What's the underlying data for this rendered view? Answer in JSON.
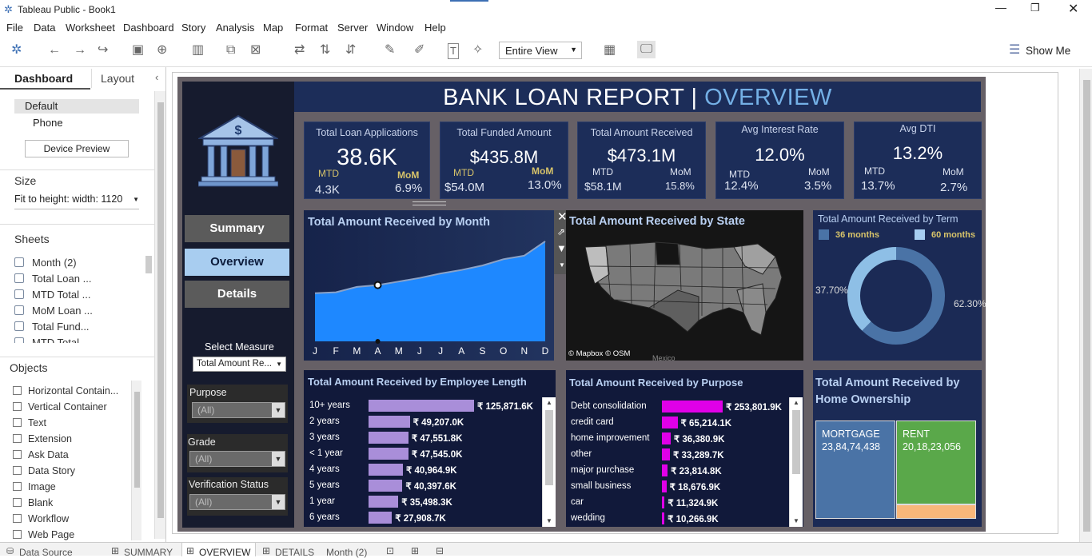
{
  "app": {
    "title": "Tableau Public - Book1"
  },
  "menu": [
    "File",
    "Data",
    "Worksheet",
    "Dashboard",
    "Story",
    "Analysis",
    "Map",
    "Format",
    "Server",
    "Window",
    "Help"
  ],
  "toolbar": {
    "view_select": "Entire View",
    "show_me": "Show Me"
  },
  "left": {
    "tab_dashboard": "Dashboard",
    "tab_layout": "Layout",
    "device_default": "Default",
    "device_phone": "Phone",
    "device_preview": "Device Preview",
    "size_title": "Size",
    "size_value": "Fit to height: width: 1120",
    "sheets_title": "Sheets",
    "sheets": [
      "Month (2)",
      "Total Loan ...",
      "MTD Total ...",
      "MoM Loan ...",
      "Total Fund...",
      "MTD Total"
    ],
    "objects_title": "Objects",
    "objects": [
      "Horizontal Contain...",
      "Vertical Container",
      "Text",
      "Extension",
      "Ask Data",
      "Data Story",
      "Image",
      "Blank",
      "Workflow",
      "Web Page"
    ]
  },
  "dashboard": {
    "header_main": "BANK LOAN REPORT |",
    "header_sub": "OVERVIEW",
    "nav": {
      "summary": "Summary",
      "overview": "Overview",
      "details": "Details"
    },
    "select_measure_label": "Select Measure",
    "select_measure_value": "Total Amount Re...",
    "filters": [
      {
        "label": "Purpose",
        "value": "(All)"
      },
      {
        "label": "Grade",
        "value": "(All)"
      },
      {
        "label": "Verification Status",
        "value": "(All)"
      }
    ],
    "kpis": [
      {
        "title": "Total Loan Applications",
        "value": "38.6K",
        "mtd_label": "MTD",
        "mtd": "4.3K",
        "mom_label": "MoM",
        "mom": "6.9%"
      },
      {
        "title": "Total Funded Amount",
        "value": "$435.8M",
        "mtd_label": "MTD",
        "mtd": "$54.0M",
        "mom_label": "MoM",
        "mom": "13.0%"
      },
      {
        "title": "Total Amount Received",
        "value": "$473.1M",
        "mtd_label": "MTD",
        "mtd": "$58.1M",
        "mom_label": "MoM",
        "mom": "15.8%"
      },
      {
        "title": "Avg Interest Rate",
        "value": "12.0%",
        "mtd_label": "MTD",
        "mtd": "12.4%",
        "mom_label": "MoM",
        "mom": "3.5%"
      },
      {
        "title": "Avg DTI",
        "value": "13.2%",
        "mtd_label": "MTD",
        "mtd": "13.7%",
        "mom_label": "MoM",
        "mom": "2.7%"
      }
    ],
    "month_title": "Total Amount Received by Month",
    "state_title": "Total Amount Received by State",
    "map_credit": "© Mapbox © OSM",
    "map_label": "Mexico",
    "term_title": "Total Amount Received by Term",
    "term_legend": [
      "36 months",
      "60 months"
    ],
    "term_labels": [
      "37.70%",
      "62.30%"
    ],
    "emp_title": "Total Amount Received by Employee Length",
    "purpose_title": "Total Amount Received by Purpose",
    "home_title_1": "Total Amount Received by",
    "home_title_2": "Home Ownership",
    "home": [
      {
        "name": "MORTGAGE",
        "value": "23,84,74,438"
      },
      {
        "name": "RENT",
        "value": "20,18,23,056"
      }
    ]
  },
  "chart_data": [
    {
      "type": "area",
      "title": "Total Amount Received by Month",
      "categories": [
        "J",
        "F",
        "M",
        "A",
        "M",
        "J",
        "J",
        "A",
        "S",
        "O",
        "N",
        "D"
      ],
      "values": [
        27.0,
        27.5,
        30.5,
        31.5,
        33.5,
        35.5,
        38.0,
        40.0,
        42.5,
        46.0,
        48.0,
        56.0
      ],
      "colors": {
        "fill": "#1e88ff",
        "line": "#8aa2c8"
      }
    },
    {
      "type": "bar",
      "title": "Total Amount Received by Employee Length",
      "categories": [
        "10+ years",
        "2 years",
        "3 years",
        "< 1 year",
        "4 years",
        "5 years",
        "1 year",
        "6 years"
      ],
      "values": [
        125871.6,
        49207.0,
        47551.8,
        47545.0,
        40964.9,
        40397.6,
        35498.3,
        27908.7
      ],
      "labels": [
        "₹ 125,871.6K",
        "₹ 49,207.0K",
        "₹ 47,551.8K",
        "₹ 47,545.0K",
        "₹ 40,964.9K",
        "₹ 40,397.6K",
        "₹ 35,498.3K",
        "₹ 27,908.7K"
      ],
      "colors": {
        "bar": "#a98ed9"
      }
    },
    {
      "type": "bar",
      "title": "Total Amount Received by Purpose",
      "categories": [
        "Debt consolidation",
        "credit card",
        "home improvement",
        "other",
        "major purchase",
        "small business",
        "car",
        "wedding"
      ],
      "values": [
        253801.9,
        65214.1,
        36380.9,
        33289.7,
        23814.8,
        18676.9,
        11324.9,
        10266.9
      ],
      "labels": [
        "₹ 253,801.9K",
        "₹ 65,214.1K",
        "₹ 36,380.9K",
        "₹ 33,289.7K",
        "₹ 23,814.8K",
        "₹ 18,676.9K",
        "₹ 11,324.9K",
        "₹ 10,266.9K"
      ],
      "colors": {
        "bar": "#e000e8"
      }
    },
    {
      "type": "pie",
      "title": "Total Amount Received by Term",
      "categories": [
        "36 months",
        "60 months"
      ],
      "values": [
        37.7,
        62.3
      ],
      "colors": {
        "36 months": "#8ebfe6",
        "60 months": "#4a73a6"
      }
    }
  ],
  "sheet_tabs": [
    "Data Source",
    "SUMMARY",
    "OVERVIEW",
    "DETAILS",
    "Month (2)"
  ]
}
